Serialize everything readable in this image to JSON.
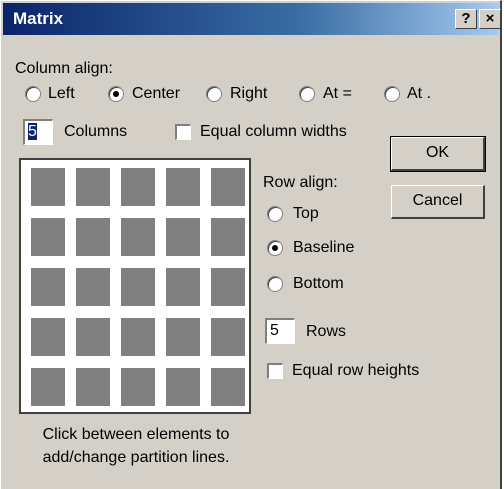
{
  "window": {
    "title": "Matrix",
    "help_glyph": "?",
    "close_glyph": "×"
  },
  "column_align": {
    "label": "Column align:",
    "options": [
      "Left",
      "Center",
      "Right",
      "At =",
      "At ."
    ],
    "selected": "Center"
  },
  "columns": {
    "value": "5",
    "label": "Columns"
  },
  "equal_column_widths": {
    "label": "Equal column widths",
    "checked": false
  },
  "row_align": {
    "label": "Row align:",
    "options": [
      "Top",
      "Baseline",
      "Bottom"
    ],
    "selected": "Baseline"
  },
  "rows": {
    "value": "5",
    "label": "Rows"
  },
  "equal_row_heights": {
    "label": "Equal row heights",
    "checked": false
  },
  "buttons": {
    "ok": "OK",
    "cancel": "Cancel"
  },
  "grid": {
    "rows": 5,
    "columns": 5
  },
  "hint": "Click between elements to add/change partition lines.",
  "colors": {
    "dialog_bg": "#d4d0c8",
    "titlebar_start": "#0a246a",
    "titlebar_end": "#a6caf0",
    "cell": "#808080"
  }
}
